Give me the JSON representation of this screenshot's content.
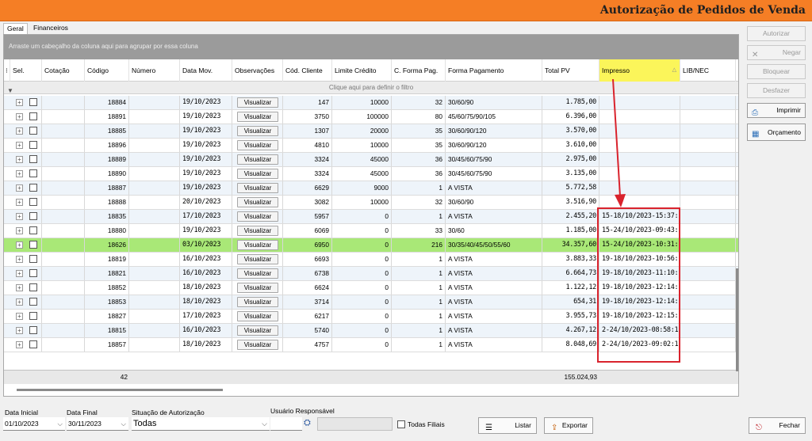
{
  "window": {
    "title": "Autorização de Pedidos de Venda"
  },
  "tabs": [
    "Geral",
    "Financeiros"
  ],
  "grid": {
    "group_hint": "Arraste um cabeçalho da coluna aqui para agrupar por essa coluna",
    "filter_hint": "Clique aqui para definir o filtro",
    "columns": [
      "Sel.",
      "Cotação",
      "Código",
      "Número",
      "Data Mov.",
      "Observações",
      "Cód. Cliente",
      "Limite Crédito",
      "C. Forma Pag.",
      "Forma Pagamento",
      "Total PV",
      "Impresso",
      "LIB/NEC"
    ],
    "view_label": "Visualizar",
    "rows": [
      {
        "codigo": "18884",
        "data": "19/10/2023",
        "cliente": "147",
        "limite": "10000",
        "cforma": "32",
        "forma": "30/60/90",
        "total": "1.785,00",
        "impresso": ""
      },
      {
        "codigo": "18891",
        "data": "19/10/2023",
        "cliente": "3750",
        "limite": "100000",
        "cforma": "80",
        "forma": "45/60/75/90/105",
        "total": "6.396,00",
        "impresso": ""
      },
      {
        "codigo": "18885",
        "data": "19/10/2023",
        "cliente": "1307",
        "limite": "20000",
        "cforma": "35",
        "forma": "30/60/90/120",
        "total": "3.570,00",
        "impresso": ""
      },
      {
        "codigo": "18896",
        "data": "19/10/2023",
        "cliente": "4810",
        "limite": "10000",
        "cforma": "35",
        "forma": "30/60/90/120",
        "total": "3.610,00",
        "impresso": ""
      },
      {
        "codigo": "18889",
        "data": "19/10/2023",
        "cliente": "3324",
        "limite": "45000",
        "cforma": "36",
        "forma": "30/45/60/75/90",
        "total": "2.975,00",
        "impresso": ""
      },
      {
        "codigo": "18890",
        "data": "19/10/2023",
        "cliente": "3324",
        "limite": "45000",
        "cforma": "36",
        "forma": "30/45/60/75/90",
        "total": "3.135,00",
        "impresso": ""
      },
      {
        "codigo": "18887",
        "data": "19/10/2023",
        "cliente": "6629",
        "limite": "9000",
        "cforma": "1",
        "forma": "A VISTA",
        "total": "5.772,58",
        "impresso": ""
      },
      {
        "codigo": "18888",
        "data": "20/10/2023",
        "cliente": "3082",
        "limite": "10000",
        "cforma": "32",
        "forma": "30/60/90",
        "total": "3.516,90",
        "impresso": ""
      },
      {
        "codigo": "18835",
        "data": "17/10/2023",
        "cliente": "5957",
        "limite": "0",
        "cforma": "1",
        "forma": "A VISTA",
        "total": "2.455,20",
        "impresso": "15-18/10/2023-15:37:"
      },
      {
        "codigo": "18880",
        "data": "19/10/2023",
        "cliente": "6069",
        "limite": "0",
        "cforma": "33",
        "forma": "30/60",
        "total": "1.185,00",
        "impresso": "15-24/10/2023-09:43:"
      },
      {
        "codigo": "18626",
        "data": "03/10/2023",
        "cliente": "6950",
        "limite": "0",
        "cforma": "216",
        "forma": "30/35/40/45/50/55/60",
        "total": "34.357,60",
        "impresso": "15-24/10/2023-10:31:"
      },
      {
        "codigo": "18819",
        "data": "16/10/2023",
        "cliente": "6693",
        "limite": "0",
        "cforma": "1",
        "forma": "A VISTA",
        "total": "3.883,33",
        "impresso": "19-18/10/2023-10:56:"
      },
      {
        "codigo": "18821",
        "data": "16/10/2023",
        "cliente": "6738",
        "limite": "0",
        "cforma": "1",
        "forma": "A VISTA",
        "total": "6.664,73",
        "impresso": "19-18/10/2023-11:10:"
      },
      {
        "codigo": "18852",
        "data": "18/10/2023",
        "cliente": "6624",
        "limite": "0",
        "cforma": "1",
        "forma": "A VISTA",
        "total": "1.122,12",
        "impresso": "19-18/10/2023-12:14:"
      },
      {
        "codigo": "18853",
        "data": "18/10/2023",
        "cliente": "3714",
        "limite": "0",
        "cforma": "1",
        "forma": "A VISTA",
        "total": "654,31",
        "impresso": "19-18/10/2023-12:14:"
      },
      {
        "codigo": "18827",
        "data": "17/10/2023",
        "cliente": "6217",
        "limite": "0",
        "cforma": "1",
        "forma": "A VISTA",
        "total": "3.955,73",
        "impresso": "19-18/10/2023-12:15:"
      },
      {
        "codigo": "18815",
        "data": "16/10/2023",
        "cliente": "5740",
        "limite": "0",
        "cforma": "1",
        "forma": "A VISTA",
        "total": "4.267,12",
        "impresso": "2-24/10/2023-08:58:1"
      },
      {
        "codigo": "18857",
        "data": "18/10/2023",
        "cliente": "4757",
        "limite": "0",
        "cforma": "1",
        "forma": "A VISTA",
        "total": "8.048,69",
        "impresso": "2-24/10/2023-09:02:1"
      }
    ],
    "selected_codigo": "18626",
    "footer_count": "42",
    "footer_total": "155.024,93"
  },
  "side_buttons": [
    {
      "label": "Autorizar",
      "enabled": false,
      "icon": ""
    },
    {
      "label": "Negar",
      "enabled": false,
      "icon": "x-icon"
    },
    {
      "label": "Bloquear",
      "enabled": false,
      "icon": ""
    },
    {
      "label": "Desfazer",
      "enabled": false,
      "icon": ""
    },
    {
      "label": "Imprimir",
      "enabled": true,
      "icon": "printer-icon"
    },
    {
      "label": "Orçamento",
      "enabled": true,
      "icon": "calculator-icon"
    }
  ],
  "bottom": {
    "data_inicial_label": "Data Inicial",
    "data_inicial": "01/10/2023",
    "data_final_label": "Data Final",
    "data_final": "30/11/2023",
    "situacao_label": "Situação de Autorização",
    "situacao": "Todas",
    "usuario_label": "Usuário Responsável",
    "todas_filiais": "Todas Filiais",
    "listar": "Listar",
    "exportar": "Exportar",
    "fechar": "Fechar"
  },
  "colors": {
    "titlebar": "#f57e25",
    "selected_row": "#a9e877",
    "highlight_header": "#fbf55a",
    "annotation": "#d9232d"
  }
}
